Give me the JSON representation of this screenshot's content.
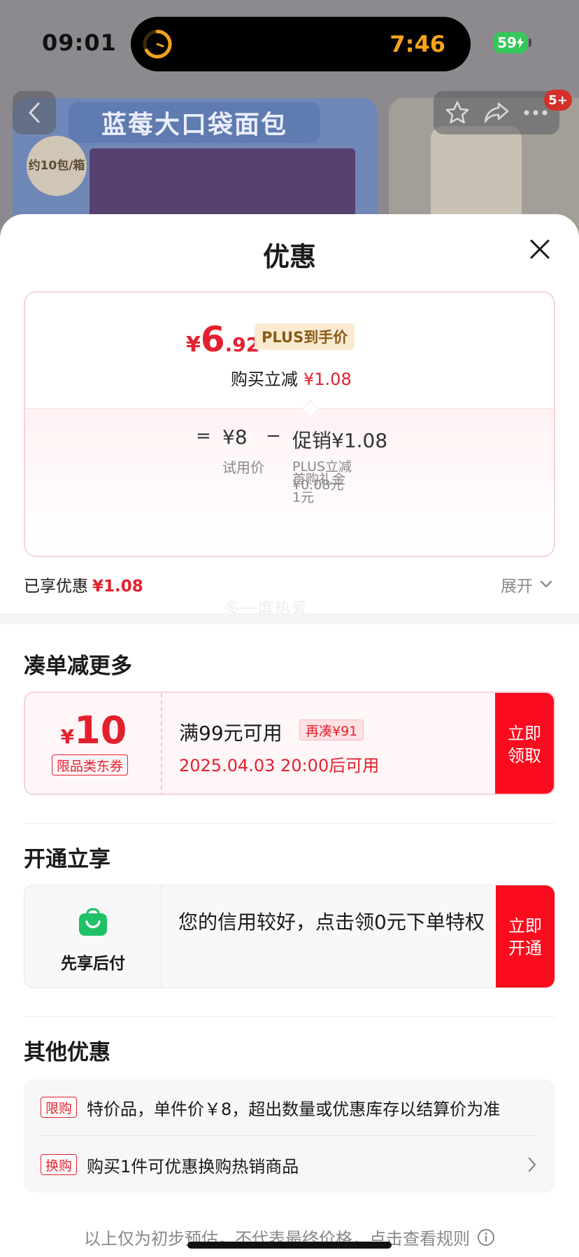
{
  "status_bar": {
    "time": "09:01",
    "timer": "7:46",
    "battery": "59"
  },
  "background": {
    "banner": "蓝莓大口袋面包",
    "badge": "约10包/箱",
    "cart_badge": "5+"
  },
  "sheet": {
    "title": "优惠",
    "price": {
      "currency": "¥",
      "integer": "6",
      "decimal": ".92"
    },
    "plus_tag": "PLUS到手价",
    "reduce_label": "购买立减",
    "reduce_amount": "¥1.08",
    "calc": {
      "eq": "=",
      "trial_value": "¥8",
      "trial_label": "试用价",
      "minus": "−",
      "promo": "促销¥1.08",
      "plus_discount_line1": "PLUS立减",
      "plus_discount_line2": "¥0.08元",
      "first_gift_line1": "首购礼金",
      "first_gift_line2": "1元"
    },
    "enjoyed_label": "已享优惠",
    "enjoyed_amount": "¥1.08",
    "expand_label": "展开",
    "watermark": "多一度热爱"
  },
  "coupon_section": {
    "title": "凑单减更多",
    "currency": "¥",
    "value": "10",
    "tag": "限品类东券",
    "condition": "满99元可用",
    "again_tag": "再凑¥91",
    "available": "2025.04.03 20:00后可用",
    "cta_line1": "立即",
    "cta_line2": "领取"
  },
  "credit_section": {
    "title": "开通立享",
    "label": "先享后付",
    "desc": "您的信用较好，点击领0元下单特权",
    "cta_line1": "立即",
    "cta_line2": "开通"
  },
  "other_section": {
    "title": "其他优惠",
    "rows": [
      {
        "tag": "限购",
        "text": "特价品，单件价￥8，超出数量或优惠库存以结算价为准"
      },
      {
        "tag": "换购",
        "text": "购买1件可优惠换购热销商品"
      }
    ]
  },
  "footnote": "以上仅为初步预估，不代表最终价格，点击查看规则",
  "colors": {
    "accent": "#e4202e",
    "cta": "#fa0c1e",
    "credit_green": "#1fc165"
  }
}
